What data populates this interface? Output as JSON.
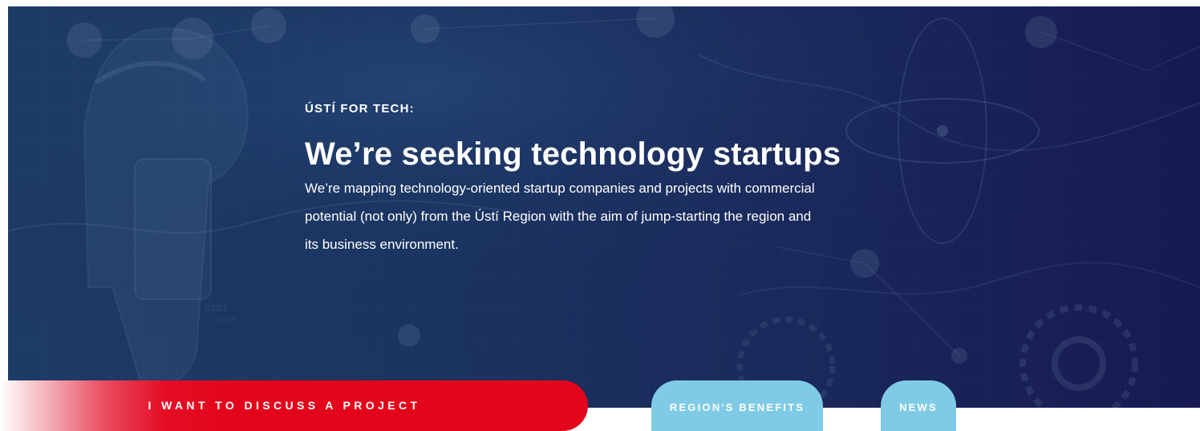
{
  "hero": {
    "eyebrow": "ÚSTÍ FOR TECH:",
    "title": "We’re seeking technology startups",
    "description_lines": [
      "We’re mapping technology-oriented startup companies and projects with commercial",
      "potential (not only) from the Ústí Region with the aim of jump-starting the region and",
      "its business environment."
    ]
  },
  "actions": {
    "discuss_project": "I WANT TO DISCUSS A PROJECT",
    "region_benefits": "REGION'S BENEFITS",
    "news": "NEWS"
  },
  "colors": {
    "hero_start": "#1e3a66",
    "hero_end": "#171a52",
    "cta_red": "#e3051b",
    "pill_blue": "#7fcbe6",
    "text": "#ffffff"
  },
  "icons": {
    "hero_illustration": "technology-network-illustration"
  }
}
